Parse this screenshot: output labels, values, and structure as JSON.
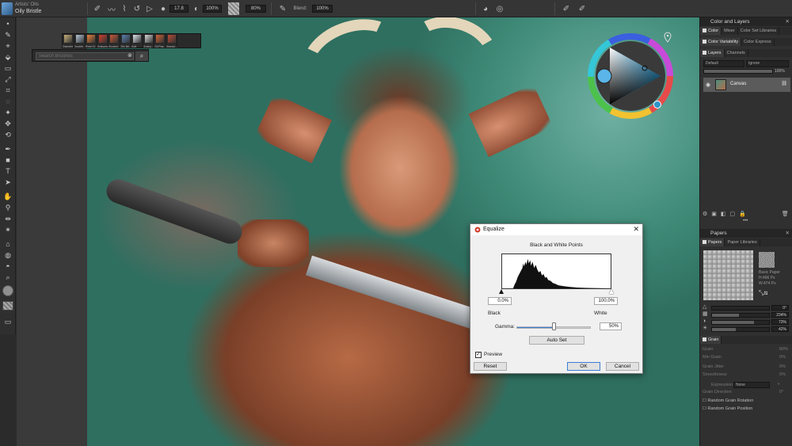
{
  "brush": {
    "category": "Artists' Oils",
    "variant": "Oily Bristle"
  },
  "propertybar": {
    "size": "17.8",
    "opacity": "100%",
    "grain": "80%",
    "blend_label": "Blend:",
    "blend": "100%"
  },
  "toolbox": {
    "icons": [
      "dot-icon",
      "brush-tool-icon",
      "dropper-tool-icon",
      "fill-tool-icon",
      "eraser-tool-icon",
      "transform-tool-icon",
      "crop-tool-icon",
      "lasso-tool-icon",
      "magic-wand-icon",
      "selection-adjust-icon",
      "rotate-icon",
      "pen-tool-icon",
      "rectangle-shape-icon",
      "text-tool-icon",
      "shape-select-icon",
      "grabber-icon",
      "dropper-icon",
      "mirror-icon",
      "kaleidoscope-icon",
      "clone-icon",
      "blend-icon",
      "burn-icon",
      "zoom-icon",
      "grabber-hand-icon"
    ]
  },
  "brush_selector": {
    "dabs": [
      {
        "name": "Distortio",
        "color": "#c8b07a"
      },
      {
        "name": "Double...",
        "color": "#b6c7d8"
      },
      {
        "name": "Real Oi...",
        "color": "#e9823b"
      },
      {
        "name": "Scissors...",
        "color": "#cf3e2b"
      },
      {
        "name": "Scratch...",
        "color": "#c95a34"
      },
      {
        "name": "Oils Bri...",
        "color": "#5a7fb0"
      },
      {
        "name": "Soft",
        "color": "#dfe6ee"
      },
      {
        "name": "Grainy...",
        "color": "#d7d7d7"
      },
      {
        "name": "Oil Pas...",
        "color": "#d06336"
      },
      {
        "name": "Smeari...",
        "color": "#b94a33"
      }
    ],
    "search_placeholder": "Search Brushes"
  },
  "color_panel": {
    "title": "Color and Layers",
    "tabs": [
      "Color",
      "Mixer",
      "Color Set Libraries"
    ],
    "tabs2": [
      "Color Variability",
      "Color Express"
    ],
    "wheel_colors": {
      "primary": "#5bb5e8",
      "secondary": "#2f95c9"
    }
  },
  "layers_panel": {
    "tabs": [
      "Layers",
      "Channels"
    ],
    "composite": "Default",
    "ignore": "Ignore",
    "opacity": "100%",
    "layer_name": "Canvas"
  },
  "papers_panel": {
    "title": "Papers",
    "tabs": [
      "Papers",
      "Paper Libraries"
    ],
    "paper_name": "Basic Paper",
    "paper_h": "H:496 Px",
    "paper_w": "W:474 Px",
    "angle": "0°",
    "scale": "234%",
    "contrast": "73%",
    "brightness": "42%",
    "scale_fraction": 0.47,
    "contrast_fraction": 0.73,
    "brightness_fraction": 0.42
  },
  "grain_panel": {
    "tab": "Grain",
    "rows": [
      {
        "label": "Grain",
        "value": "80%"
      },
      {
        "label": "Min Grain",
        "value": "0%"
      },
      {
        "label": "Grain Jitter",
        "value": "0%"
      },
      {
        "label": "Smoothness",
        "value": "0%"
      }
    ],
    "expression_label": "Expression:",
    "expression": "None",
    "direction_label": "Grain Direction",
    "direction": "0°",
    "checks": [
      "Random Grain Rotation",
      "Random Grain Position"
    ]
  },
  "dialog": {
    "title": "Equalize",
    "subtitle": "Black and White Points",
    "black_value": "0.0%",
    "white_value": "100.0%",
    "black_label": "Black",
    "white_label": "White",
    "gamma_label": "Gamma:",
    "gamma_value": "50%",
    "gamma_fraction": 0.5,
    "auto_set": "Auto Set",
    "preview_label": "Preview",
    "preview_checked": "✓",
    "reset": "Reset",
    "ok": "OK",
    "cancel": "Cancel"
  }
}
